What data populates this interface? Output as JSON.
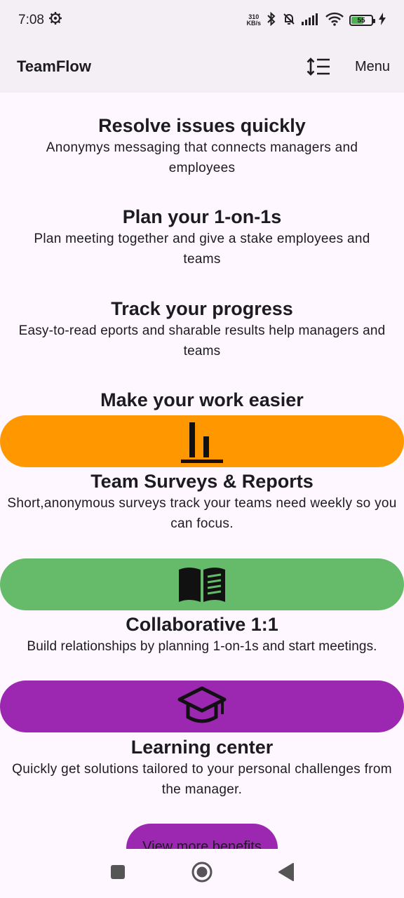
{
  "status_bar": {
    "time": "7:08",
    "net_speed_value": "310",
    "net_speed_unit": "KB/s",
    "battery": "55",
    "battery_level": 0.55
  },
  "app_bar": {
    "title": "TeamFlow",
    "menu_label": "Menu"
  },
  "intro": [
    {
      "title": "Resolve issues quickly",
      "text": "Anonymys messaging that connects managers and employees"
    },
    {
      "title": "Plan your 1-on-1s",
      "text": "Plan meeting together and give a stake employees and teams"
    },
    {
      "title": "Track your progress",
      "text": "Easy-to-read eports and sharable results help managers and teams"
    }
  ],
  "benefits_heading": "Make your work easier",
  "benefits": [
    {
      "title": "Team Surveys & Reports",
      "text": "Short,anonymous surveys track your teams need weekly so you can focus.",
      "color": "#ff9800",
      "icon": "bar-chart-icon"
    },
    {
      "title": "Collaborative 1:1",
      "text": "Build relationships by planning 1-on-1s and start meetings.",
      "color": "#66bb6a",
      "icon": "book-icon"
    },
    {
      "title": "Learning center",
      "text": "Quickly get solutions tailored to your personal challenges from the manager.",
      "color": "#9c27b0",
      "icon": "graduation-cap-icon"
    }
  ],
  "cta_label": "View more benefits",
  "colors": {
    "background": "#fef7ff",
    "app_bar": "#f3eff4",
    "cta": "#9c27b0"
  }
}
